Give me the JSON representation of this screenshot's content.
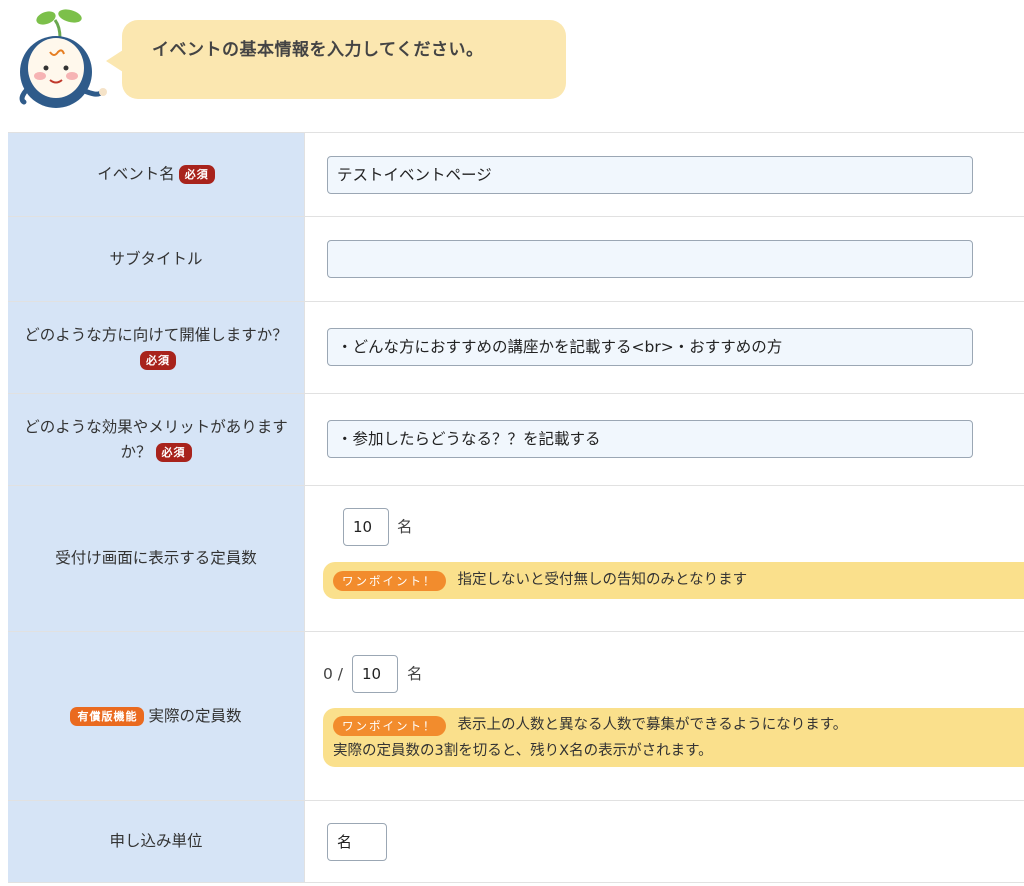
{
  "header": {
    "speech": "イベントの基本情報を入力してください。"
  },
  "badges": {
    "required": "必須",
    "paid": "有償版機能",
    "tip": "ワンポイント！"
  },
  "fields": {
    "event_name": {
      "label": "イベント名",
      "value": "テストイベントページ"
    },
    "subtitle": {
      "label": "サブタイトル",
      "value": ""
    },
    "target_audience": {
      "label": "どのような方に向けて開催しますか？",
      "value": "・どんな方におすすめの講座かを記載する<br>・おすすめの方"
    },
    "benefits": {
      "label": "どのような効果やメリットがありますか？",
      "value": "・参加したらどうなる？？を記載する"
    },
    "display_capacity": {
      "label": "受付け画面に表示する定員数",
      "value": "10",
      "unit": "名",
      "tip": "指定しないと受付無しの告知のみとなります"
    },
    "actual_capacity": {
      "label": "実際の定員数",
      "current": "0 /",
      "value": "10",
      "unit": "名",
      "tip_line1": "表示上の人数と異なる人数で募集ができるようになります。",
      "tip_line2": "実際の定員数の3割を切ると、残りX名の表示がされます。"
    },
    "application_unit": {
      "label": "申し込み単位",
      "value": "名"
    }
  },
  "colors": {
    "label_bg": "#d6e4f6",
    "required_badge": "#a8231c",
    "paid_badge": "#ea6a1f",
    "tip_bg": "#fae08c",
    "tip_badge": "#f28c2d",
    "speech_bg": "#fbe7b0"
  }
}
